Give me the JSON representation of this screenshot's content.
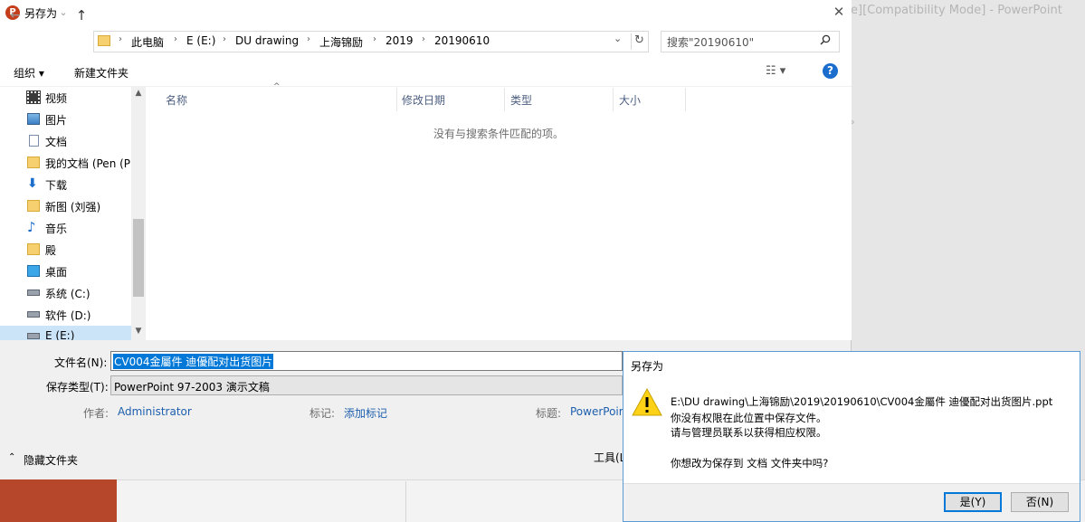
{
  "background_window": {
    "title": "e][Compatibility Mode]  -  PowerPoint"
  },
  "dialog": {
    "title": "另存为",
    "app_icon_letter": "P",
    "close_glyph": "✕"
  },
  "nav": {
    "back": "←",
    "forward": "→",
    "recent": "⌄",
    "up": "↑",
    "breadcrumb": [
      "此电脑",
      "E (E:)",
      "DU drawing",
      "上海锦励",
      "2019",
      "20190610"
    ],
    "refresh": "↻",
    "dropdown": "⌄",
    "search_placeholder": "搜索\"20190610\""
  },
  "toolbar": {
    "organize": "组织 ▾",
    "new_folder": "新建文件夹",
    "view": "☷ ▾",
    "help": "?"
  },
  "sidebar": {
    "items": [
      {
        "label": "视频",
        "icon": "video-icon"
      },
      {
        "label": "图片",
        "icon": "pictures-icon"
      },
      {
        "label": "文档",
        "icon": "documents-icon"
      },
      {
        "label": "我的文档 (Pen (PE",
        "icon": "folder-icon"
      },
      {
        "label": "下载",
        "icon": "download-icon"
      },
      {
        "label": "新图 (刘强)",
        "icon": "folder-icon"
      },
      {
        "label": "音乐",
        "icon": "music-icon"
      },
      {
        "label": "殿",
        "icon": "folder-icon"
      },
      {
        "label": "桌面",
        "icon": "desktop-icon"
      },
      {
        "label": "系统 (C:)",
        "icon": "drive-icon"
      },
      {
        "label": "软件 (D:)",
        "icon": "drive-icon"
      },
      {
        "label": "E (E:)",
        "icon": "drive-icon"
      }
    ]
  },
  "filelist": {
    "columns": [
      "名称",
      "修改日期",
      "类型",
      "大小"
    ],
    "empty_message": "没有与搜索条件匹配的项。"
  },
  "form": {
    "filename_label": "文件名(N):",
    "filename_value": "CV004金屬件 迪優配对出货图片",
    "filetype_label": "保存类型(T):",
    "filetype_value": "PowerPoint 97-2003 演示文稿",
    "author_label": "作者:",
    "author_value": "Administrator",
    "tags_label": "标记:",
    "tags_value": "添加标记",
    "title_label": "标题:",
    "title_value": "PowerPoir",
    "hide_folders": "隐藏文件夹",
    "tools": "工具(L"
  },
  "popup": {
    "title": "另存为",
    "lines": [
      "E:\\DU drawing\\上海锦励\\2019\\20190610\\CV004金屬件 迪優配对出货图片.ppt",
      "你没有权限在此位置中保存文件。",
      "请与管理员联系以获得相应权限。",
      "你想改为保存到 文档 文件夹中吗?"
    ],
    "yes": "是(Y)",
    "no": "否(N)"
  }
}
